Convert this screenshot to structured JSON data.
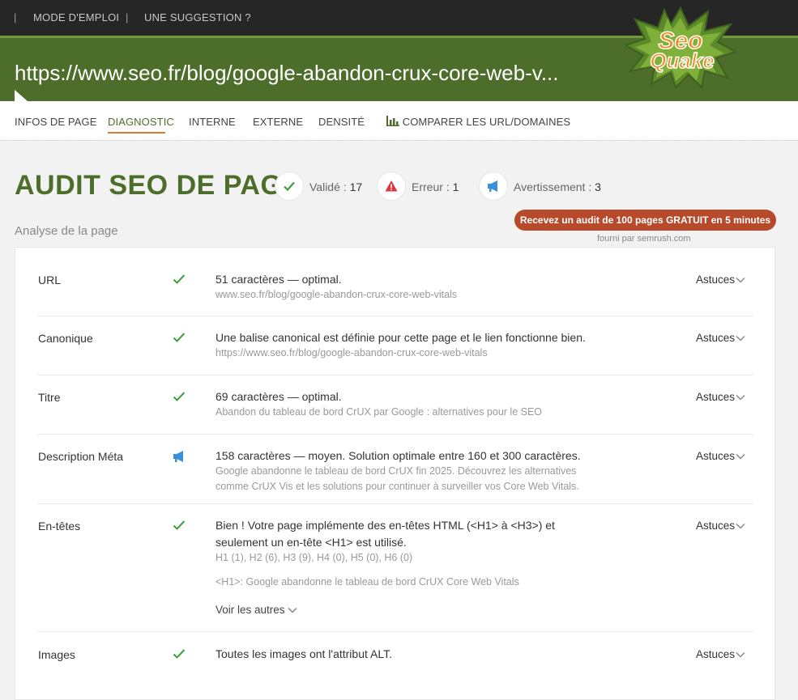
{
  "topbar": {
    "separator": "|",
    "link1": "MODE D'EMPLOI",
    "link2": "UNE SUGGESTION ?"
  },
  "header": {
    "url": "https://www.seo.fr/blog/google-abandon-crux-core-web-v...",
    "logo_line1": "Seo",
    "logo_line2": "Quake"
  },
  "nav": {
    "tabs": [
      "INFOS DE PAGE",
      "DIAGNOSTIC",
      "INTERNE",
      "EXTERNE",
      "DENSITÉ",
      "COMPARER LES URL/DOMAINES"
    ],
    "active": "DIAGNOSTIC"
  },
  "audit": {
    "title": "AUDIT SEO DE PAGE",
    "valid_label": "Validé :",
    "valid_count": "17",
    "error_label": "Erreur :",
    "error_count": "1",
    "warning_label": "Avertissement :",
    "warning_count": "3",
    "subtitle": "Analyse de la page",
    "cta": "Recevez un audit de 100 pages GRATUIT en 5 minutes",
    "powered": "fourni par  semrush.com"
  },
  "colors": {
    "brand_green": "#4d6e2b",
    "check_green": "#3aa13a",
    "warning_blue": "#3b8fd6",
    "error_red": "#d9363e",
    "cta_red": "#b84a2c",
    "tab_underline": "#e07b2c"
  },
  "rows": [
    {
      "name": "URL",
      "status": "check-icon",
      "main": "51 caractères — optimal.",
      "sub": "www.seo.fr/blog/google-abandon-crux-core-web-vitals",
      "tips": "Astuces"
    },
    {
      "name": "Canonique",
      "status": "check-icon",
      "main": "Une balise canonical est définie pour cette page et le lien fonctionne bien.",
      "sub": "https://www.seo.fr/blog/google-abandon-crux-core-web-vitals",
      "tips": "Astuces"
    },
    {
      "name": "Titre",
      "status": "check-icon",
      "main": "69 caractères — optimal.",
      "sub": "Abandon du tableau de bord CrUX par Google : alternatives pour le SEO",
      "tips": "Astuces"
    },
    {
      "name": "Description Méta",
      "status": "megaphone-icon",
      "main": "158 caractères — moyen. Solution optimale entre 160 et 300 caractères.",
      "sub": "Google abandonne le tableau de bord CrUX fin 2025. Découvrez les alternatives comme CrUX Vis et les solutions pour continuer à surveiller vos Core Web Vitals.",
      "tips": "Astuces"
    },
    {
      "name": "En-têtes",
      "status": "check-icon",
      "main": "Bien ! Votre page implémente des en-têtes HTML (<H1> à <H3>) et seulement un en-tête <H1> est utilisé.",
      "sub": "H1 (1), H2 (6), H3 (9), H4 (0), H5 (0), H6 (0)",
      "sub2": "<H1>: Google abandonne le tableau de bord CrUX Core Web Vitals",
      "more": "Voir les autres",
      "tips": "Astuces"
    },
    {
      "name": "Images",
      "status": "check-icon",
      "main": "Toutes les images ont l'attribut ALT.",
      "tips": "Astuces"
    }
  ]
}
